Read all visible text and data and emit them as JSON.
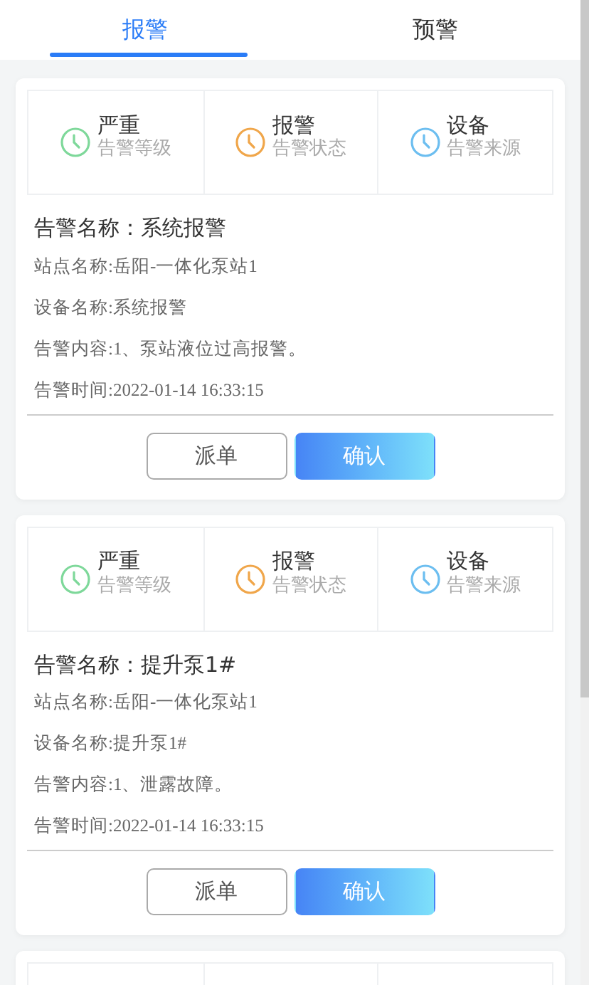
{
  "tabs": [
    {
      "label": "报警",
      "selected": true
    },
    {
      "label": "预警",
      "selected": false
    }
  ],
  "alarms": [
    {
      "stats": [
        {
          "value": "严重",
          "label": "告警等级",
          "color": "#7ed89a"
        },
        {
          "value": "报警",
          "label": "告警状态",
          "color": "#f0a64a"
        },
        {
          "value": "设备",
          "label": "告警来源",
          "color": "#6cbef0"
        }
      ],
      "title": "告警名称：系统报警",
      "lines": [
        "站点名称:岳阳-一体化泵站1",
        "设备名称:系统报警",
        "告警内容:1、泵站液位过高报警。",
        "告警时间:2022-01-14 16:33:15"
      ],
      "buttons": [
        {
          "label": "派单",
          "kind": "outline"
        },
        {
          "label": "确认",
          "kind": "primary"
        }
      ]
    },
    {
      "stats": [
        {
          "value": "严重",
          "label": "告警等级",
          "color": "#7ed89a"
        },
        {
          "value": "报警",
          "label": "告警状态",
          "color": "#f0a64a"
        },
        {
          "value": "设备",
          "label": "告警来源",
          "color": "#6cbef0"
        }
      ],
      "title": "告警名称：提升泵1#",
      "lines": [
        "站点名称:岳阳-一体化泵站1",
        "设备名称:提升泵1#",
        "告警内容:1、泄露故障。",
        "告警时间:2022-01-14 16:33:15"
      ],
      "buttons": [
        {
          "label": "派单",
          "kind": "outline"
        },
        {
          "label": "确认",
          "kind": "primary"
        }
      ]
    },
    {
      "kind": "card"
    }
  ]
}
